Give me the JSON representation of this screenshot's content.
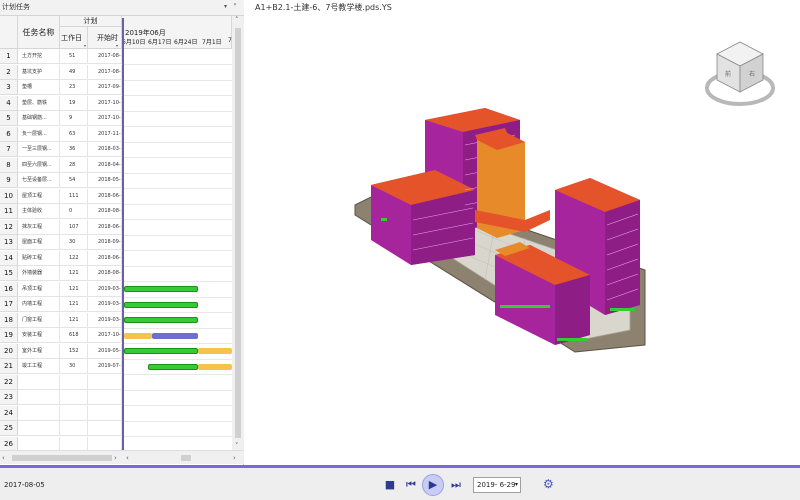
{
  "panel": {
    "title": "计划任务",
    "dropdown_icon": "▾",
    "pin_icon": "ᵖ"
  },
  "grid": {
    "group_header": "计划",
    "col_name": "任务名称",
    "col_days": "工作日",
    "col_start": "开始时",
    "gantt_month": "2019年06月",
    "gantt_weeks": [
      "6月10日",
      "6月17日",
      "6月24日",
      "7月1日",
      "7"
    ],
    "rows": [
      {
        "num": "1",
        "name": "土方开挖",
        "days": "51",
        "start": "2017-08-"
      },
      {
        "num": "2",
        "name": "基坑支护",
        "days": "49",
        "start": "2017-08-"
      },
      {
        "num": "3",
        "name": "垫槽",
        "days": "23",
        "start": "2017-09-"
      },
      {
        "num": "4",
        "name": "垫层、筋铁",
        "days": "19",
        "start": "2017-10-"
      },
      {
        "num": "5",
        "name": "基础钢筋...",
        "days": "9",
        "start": "2017-10-"
      },
      {
        "num": "6",
        "name": "负一层钢...",
        "days": "63",
        "start": "2017-11-"
      },
      {
        "num": "7",
        "name": "一至三层钢...",
        "days": "36",
        "start": "2018-03-"
      },
      {
        "num": "8",
        "name": "四至六层钢...",
        "days": "28",
        "start": "2018-04-"
      },
      {
        "num": "9",
        "name": "七至设备层...",
        "days": "54",
        "start": "2018-05-"
      },
      {
        "num": "10",
        "name": "屋顶工程",
        "days": "111",
        "start": "2018-06-"
      },
      {
        "num": "11",
        "name": "主体验收",
        "days": "0",
        "start": "2018-08-"
      },
      {
        "num": "12",
        "name": "抹灰工程",
        "days": "107",
        "start": "2018-06-"
      },
      {
        "num": "13",
        "name": "屋面工程",
        "days": "30",
        "start": "2018-09-"
      },
      {
        "num": "14",
        "name": "贴砖工程",
        "days": "122",
        "start": "2018-06-"
      },
      {
        "num": "15",
        "name": "外墙装器",
        "days": "121",
        "start": "2018-08-"
      },
      {
        "num": "16",
        "name": "吊顶工程",
        "days": "121",
        "start": "2019-03-"
      },
      {
        "num": "17",
        "name": "内墙工程",
        "days": "121",
        "start": "2019-03-"
      },
      {
        "num": "18",
        "name": "门窗工程",
        "days": "121",
        "start": "2019-03-"
      },
      {
        "num": "19",
        "name": "安装工程",
        "days": "618",
        "start": "2017-10-"
      },
      {
        "num": "20",
        "name": "室外工程",
        "days": "152",
        "start": "2019-05-"
      },
      {
        "num": "21",
        "name": "竣工工程",
        "days": "30",
        "start": "2019-07-"
      },
      {
        "num": "22",
        "name": "",
        "days": "",
        "start": ""
      },
      {
        "num": "23",
        "name": "",
        "days": "",
        "start": ""
      },
      {
        "num": "24",
        "name": "",
        "days": "",
        "start": ""
      },
      {
        "num": "25",
        "name": "",
        "days": "",
        "start": ""
      },
      {
        "num": "26",
        "name": "",
        "days": "",
        "start": ""
      }
    ]
  },
  "viewport": {
    "title": "A1+B2.1-土建-6、7号教学楼.pds.YS"
  },
  "toolbar": {
    "sim_date": "2017-08-05",
    "stop_icon": "■",
    "prev_icon": "⏮",
    "play_icon": "▶",
    "next_icon": "⏭",
    "date_value": "2019-  6-29",
    "date_arrow": "▾",
    "settings_icon": "⚙"
  },
  "colors": {
    "accent": "#7a6ad0",
    "bar_green": "#33cc33",
    "bar_yellow": "#f4c34e",
    "bar_blue": "#6e6ecf",
    "building_roof": "#e0502a",
    "building_wall": "#b02aa5"
  }
}
